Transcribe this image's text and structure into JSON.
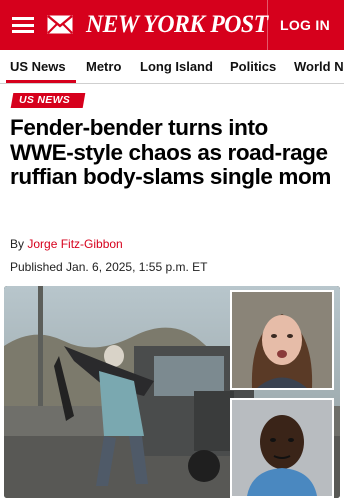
{
  "header": {
    "brand": "NEW YORK POST",
    "login_label": "LOG IN",
    "menu_icon": "hamburger-menu-icon",
    "mail_icon": "envelope-icon",
    "brand_color": "#d6001c"
  },
  "nav": {
    "items": [
      {
        "label": "US News",
        "active": true
      },
      {
        "label": "Metro"
      },
      {
        "label": "Long Island"
      },
      {
        "label": "Politics"
      },
      {
        "label": "World News"
      }
    ]
  },
  "article": {
    "section": "US NEWS",
    "headline": "Fender-bender turns into WWE-style chaos as road-rage ruffian body-slams single mom",
    "byline_prefix": "By ",
    "author": "Jorge Fitz-Gibbon",
    "published": "Published Jan. 6, 2025, 1:55 p.m. ET"
  }
}
